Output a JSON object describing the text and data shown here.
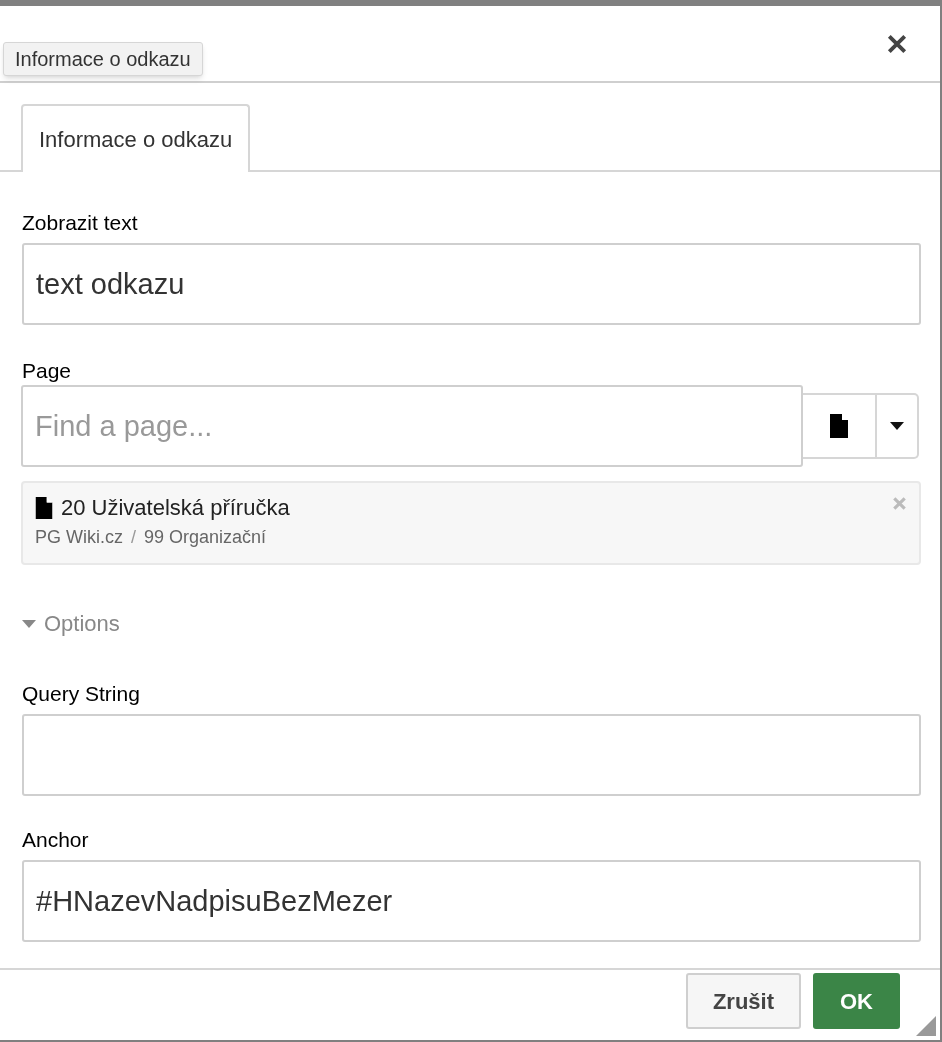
{
  "tooltip": "Informace o odkazu",
  "tabs": [
    {
      "label": "Informace o odkazu",
      "selected": true
    }
  ],
  "display_text": {
    "label": "Zobrazit text",
    "value": "text odkazu"
  },
  "page": {
    "label": "Page",
    "placeholder": "Find a page...",
    "selected_page": {
      "title": "20 Uživatelská příručka",
      "path": [
        "PG Wiki.cz",
        "99 Organizační"
      ],
      "separator": "/"
    }
  },
  "options": {
    "label": "Options",
    "expanded": true
  },
  "query_string": {
    "label": "Query String"
  },
  "anchor": {
    "label": "Anchor",
    "value": "#HNazevNadpisuBezMezer"
  },
  "buttons": [
    {
      "label": "Zrušit",
      "kind": "secondary"
    },
    {
      "label": "OK",
      "kind": "primary"
    }
  ]
}
